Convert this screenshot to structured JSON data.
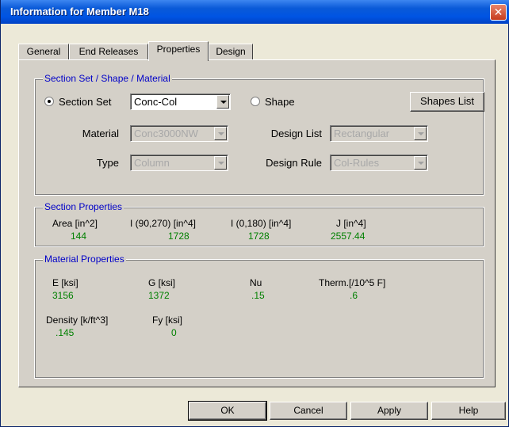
{
  "window": {
    "title": "Information for Member M18"
  },
  "tabs": [
    {
      "label": "General"
    },
    {
      "label": "End Releases"
    },
    {
      "label": "Properties"
    },
    {
      "label": "Design"
    }
  ],
  "active_tab": "Properties",
  "section_group": {
    "title": "Section Set / Shape / Material",
    "section_set_radio_label": "Section Set",
    "section_set_selected": true,
    "section_set_value": "Conc-Col",
    "shape_radio_label": "Shape",
    "shape_selected": false,
    "shapes_list_button": "Shapes List",
    "material_label": "Material",
    "material_value": "Conc3000NW",
    "type_label": "Type",
    "type_value": "Column",
    "design_list_label": "Design List",
    "design_list_value": "Rectangular",
    "design_rule_label": "Design Rule",
    "design_rule_value": "Col-Rules"
  },
  "section_properties": {
    "title": "Section Properties",
    "items": [
      {
        "label": "Area [in^2]",
        "value": "144"
      },
      {
        "label": "I (90,270) [in^4]",
        "value": "1728"
      },
      {
        "label": "I (0,180) [in^4]",
        "value": "1728"
      },
      {
        "label": "J [in^4]",
        "value": "2557.44"
      }
    ]
  },
  "material_properties": {
    "title": "Material Properties",
    "items": [
      {
        "label": "E [ksi]",
        "value": "3156"
      },
      {
        "label": "G [ksi]",
        "value": "1372"
      },
      {
        "label": "Nu",
        "value": ".15"
      },
      {
        "label": "Therm.[/10^5 F]",
        "value": ".6"
      },
      {
        "label": "Density [k/ft^3]",
        "value": ".145"
      },
      {
        "label": "Fy [ksi]",
        "value": "0"
      }
    ]
  },
  "buttons": {
    "ok": "OK",
    "cancel": "Cancel",
    "apply": "Apply",
    "help": "Help"
  },
  "colors": {
    "title_bar": "#0054e3",
    "group_title": "#0000c8",
    "value_text": "#008000",
    "dialog_bg": "#d4d0c8"
  }
}
